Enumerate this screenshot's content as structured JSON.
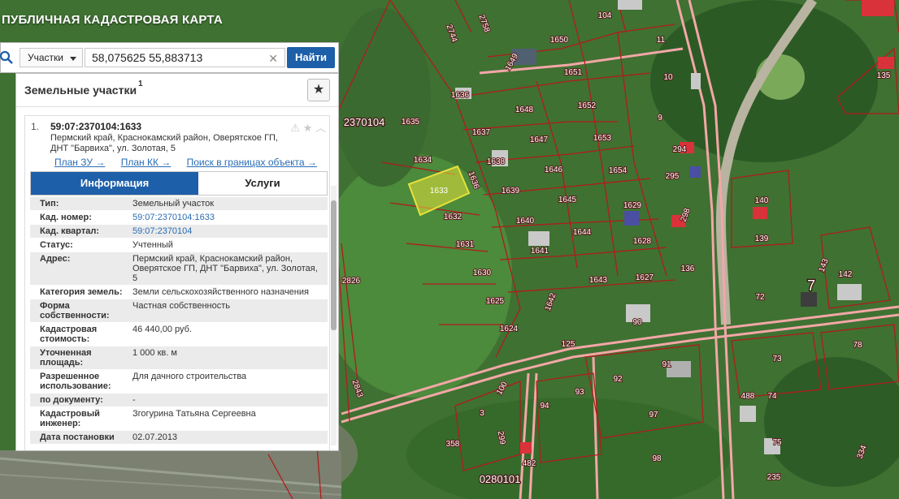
{
  "app_title": "ПУБЛИЧНАЯ КАДАСТРОВАЯ КАРТА",
  "search": {
    "type_value": "Участки",
    "query": "58,075625 55,883713",
    "find_label": "Найти",
    "clear_glyph": "✕"
  },
  "panel": {
    "title": "Земельные участки",
    "count": "1"
  },
  "result": {
    "number": "1.",
    "cadastral_number": "59:07:2370104:1633",
    "address": "Пермский край, Краснокамский район, Оверятское ГП, ДНТ \"Барвиха\", ул. Золотая, 5",
    "links": [
      "План ЗУ →",
      "План КК →",
      "Поиск в границах объекта →"
    ],
    "tabs": {
      "info": "Информация",
      "services": "Услуги"
    },
    "properties": [
      {
        "key": "Тип:",
        "value": "Земельный участок"
      },
      {
        "key": "Кад. номер:",
        "value": "59:07:2370104:1633"
      },
      {
        "key": "Кад. квартал:",
        "value": "59:07:2370104"
      },
      {
        "key": "Статус:",
        "value": "Учтенный"
      },
      {
        "key": "Адрес:",
        "value": "Пермский край, Краснокамский район, Оверятское ГП, ДНТ \"Барвиха\", ул. Золотая, 5"
      },
      {
        "key": "Категория земель:",
        "value": "Земли сельскохозяйственного назначения"
      },
      {
        "key": "Форма собственности:",
        "value": "Частная собственность"
      },
      {
        "key": "Кадастровая стоимость:",
        "value": "46 440,00 руб."
      },
      {
        "key": "Уточненная площадь:",
        "value": "1 000 кв. м"
      },
      {
        "key": "Разрешенное использование:",
        "value": "Для дачного строительства"
      },
      {
        "key": "по документу:",
        "value": "-"
      },
      {
        "key": "Кадастровый инженер:",
        "value": "Згогурина Татьяна Сергеевна"
      },
      {
        "key": "Дата постановки",
        "value": "02.07.2013"
      }
    ]
  },
  "map": {
    "quarter_label": "2370104",
    "quarter_label_2": "0280101",
    "district_number": "7",
    "selected_parcel": "1633",
    "parcel_labels": [
      "1650",
      "1649",
      "1651",
      "1636",
      "1648",
      "1652",
      "1635",
      "1637",
      "1647",
      "1653",
      "1634",
      "1638",
      "1646",
      "1654",
      "1636",
      "1639",
      "1645",
      "1629",
      "1632",
      "1640",
      "1644",
      "1628",
      "1631",
      "1641",
      "1630",
      "1643",
      "1627",
      "1625",
      "1642",
      "1624",
      "2744",
      "2758",
      "2826",
      "2843",
      "104",
      "11",
      "10",
      "9",
      "294",
      "295",
      "298",
      "140",
      "139",
      "135",
      "136",
      "143",
      "142",
      "90",
      "125",
      "91",
      "72",
      "73",
      "78",
      "92",
      "93",
      "94",
      "97",
      "100",
      "488",
      "74",
      "358",
      "482",
      "98",
      "75",
      "235",
      "3",
      "299",
      "334"
    ]
  },
  "colors": {
    "accent": "#1d5fa8",
    "parcel_border": "#b01c1c",
    "road_border": "#f3a7a7",
    "selected_fill": "#e6e23a"
  }
}
